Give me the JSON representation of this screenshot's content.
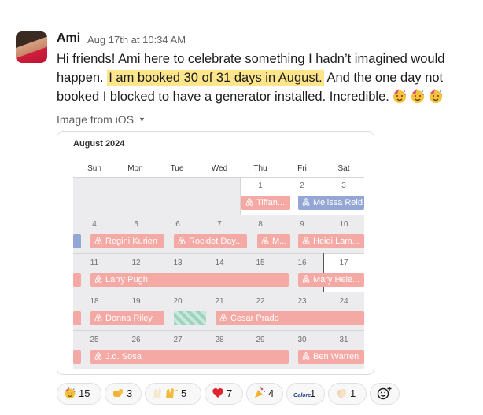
{
  "message": {
    "author": "Ami",
    "timestamp": "Aug 17th at 10:34 AM",
    "text_a": "Hi friends!  Ami here to celebrate something I hadn’t imagined would happen. ",
    "text_highlight": "I am booked 30 of 31 days in August.",
    "text_b": " And the one day not booked I blocked to have a generator installed.  Incredible."
  },
  "image_source": "Image from iOS",
  "calendar": {
    "title": "August 2024",
    "daynames": [
      "Sun",
      "Mon",
      "Tue",
      "Wed",
      "Thu",
      "Fri",
      "Sat"
    ],
    "week0": [
      "1",
      "2",
      "3"
    ],
    "week1": [
      "4",
      "5",
      "6",
      "7",
      "8",
      "9",
      "10"
    ],
    "week2": [
      "11",
      "12",
      "13",
      "14",
      "15",
      "16",
      "17"
    ],
    "week3": [
      "18",
      "19",
      "20",
      "21",
      "22",
      "23",
      "24"
    ],
    "week4": [
      "25",
      "26",
      "27",
      "28",
      "29",
      "30",
      "31"
    ],
    "bookings": {
      "tiffany": "Tiffan...",
      "melissa": "Melissa Reid",
      "regini": "Regini Kurien",
      "rocidet": "Rocidet Day...",
      "m": "M...",
      "heidi": "Heidi Lam...",
      "larry": "Larry Pugh",
      "mary": "Mary Hele...",
      "donna": "Donna Riley",
      "cesar": "Cesar Prado",
      "jd": "J.d. Sosa",
      "ben": "Ben Warren"
    },
    "colors": {
      "booking": "#f4a9a5",
      "blocked": "#9fd3c0",
      "other": "#93a6d6"
    }
  },
  "reactions": [
    {
      "icon": "party-face",
      "count": "15"
    },
    {
      "icon": "fist-bump",
      "count": "3"
    },
    {
      "icon": "raised-hands",
      "count": "5"
    },
    {
      "icon": "red-heart",
      "count": "7"
    },
    {
      "icon": "party-popper",
      "count": "4"
    },
    {
      "icon": "galore-badge",
      "label": "Galore",
      "count": "1"
    },
    {
      "icon": "clapping-hands",
      "count": "1"
    }
  ]
}
